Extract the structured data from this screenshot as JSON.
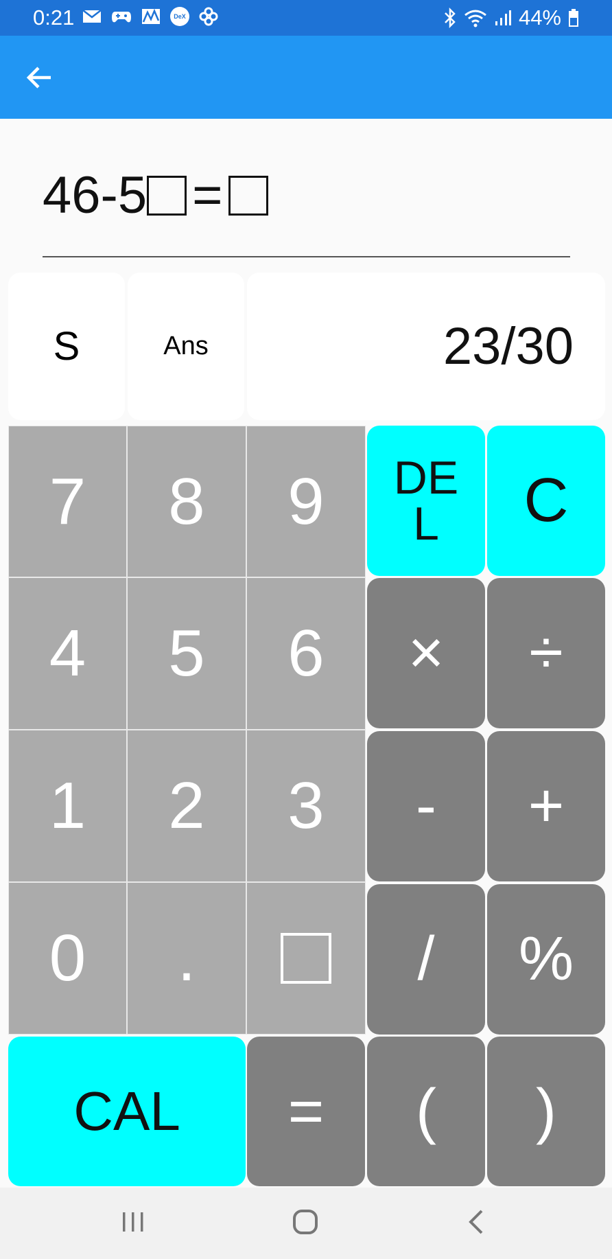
{
  "status_bar": {
    "time": "0:21",
    "battery": "44%",
    "icons": [
      "mail-icon",
      "game-icon",
      "chart-icon",
      "dex-icon",
      "pinwheel-icon",
      "bluetooth-icon",
      "wifi-icon",
      "signal-icon",
      "battery-icon"
    ],
    "dex_label": "DeX"
  },
  "app_bar": {
    "back_icon": "arrow-back-icon",
    "color": "#2196f3"
  },
  "expression": {
    "part1": "46-5",
    "part2": "=",
    "placeholder_boxes": 2
  },
  "top_row": {
    "s_label": "S",
    "ans_label": "Ans",
    "score": "23/30"
  },
  "keypad": {
    "row1": [
      "7",
      "8",
      "9"
    ],
    "row2": [
      "4",
      "5",
      "6"
    ],
    "row3": [
      "1",
      "2",
      "3"
    ],
    "row4": [
      "0",
      "."
    ],
    "box_key": "box-key",
    "del": "DE\nL",
    "clear": "C",
    "multiply": "×",
    "divide": "÷",
    "minus": "-",
    "plus": "+",
    "slash": "/",
    "percent": "%",
    "cal": "CAL",
    "equals": "=",
    "lparen": "(",
    "rparen": ")"
  },
  "colors": {
    "digit": "#ababab",
    "operator": "#808080",
    "accent": "#00ffff",
    "status": "#1e73d6"
  },
  "nav_bar": {
    "icons": [
      "recents-icon",
      "home-icon",
      "back-icon"
    ]
  }
}
